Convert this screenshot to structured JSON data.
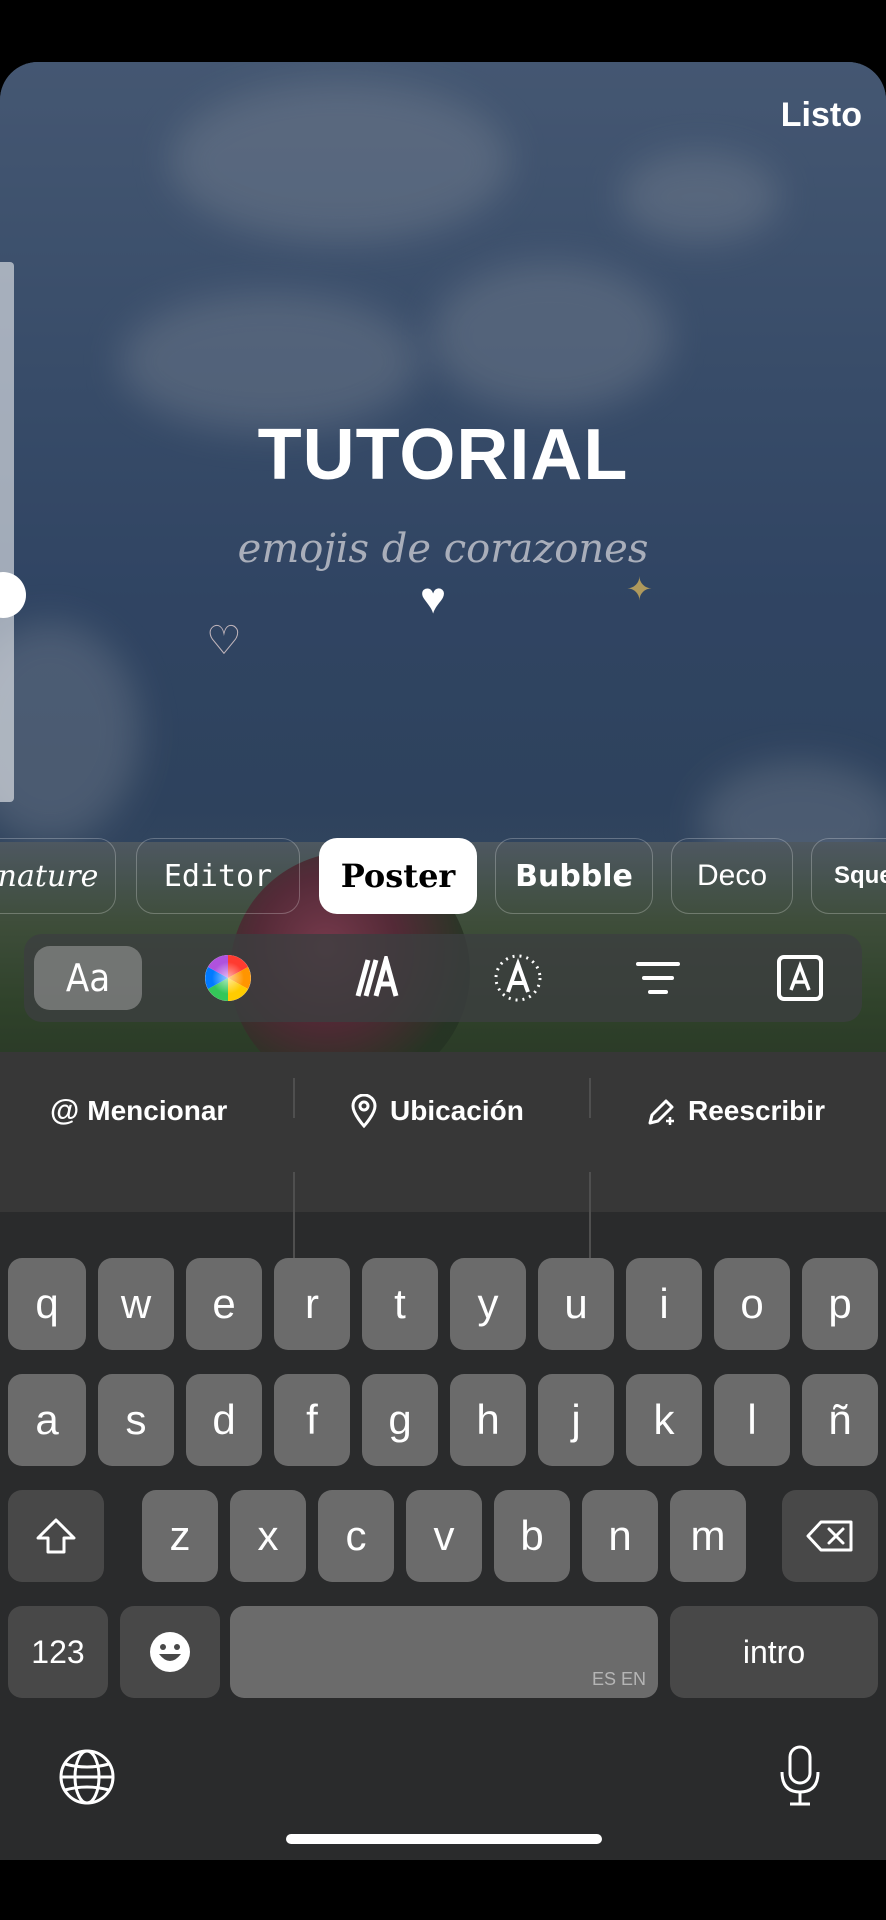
{
  "header": {
    "done_label": "Listo"
  },
  "canvas": {
    "title": "TUTORIAL",
    "subtitle": "emojis de corazones"
  },
  "text_styles": {
    "items": [
      "nature",
      "Editor",
      "Poster",
      "Bubble",
      "Deco",
      "Squee"
    ],
    "selected": "Poster"
  },
  "text_tools": {
    "font_label": "Aa"
  },
  "suggestions": {
    "mention": "Mencionar",
    "location": "Ubicación",
    "rewrite": "Reescribir"
  },
  "keyboard": {
    "row1": [
      "q",
      "w",
      "e",
      "r",
      "t",
      "y",
      "u",
      "i",
      "o",
      "p"
    ],
    "row2": [
      "a",
      "s",
      "d",
      "f",
      "g",
      "h",
      "j",
      "k",
      "l",
      "ñ"
    ],
    "row3": [
      "z",
      "x",
      "c",
      "v",
      "b",
      "n",
      "m"
    ],
    "numbers_label": "123",
    "return_label": "intro",
    "language_label": "ES EN"
  },
  "colors": {
    "accent_white": "#ffffff",
    "key": "#6b6b6b",
    "key_dark": "#484848",
    "keyboard_bg": "#2a2b2c"
  }
}
